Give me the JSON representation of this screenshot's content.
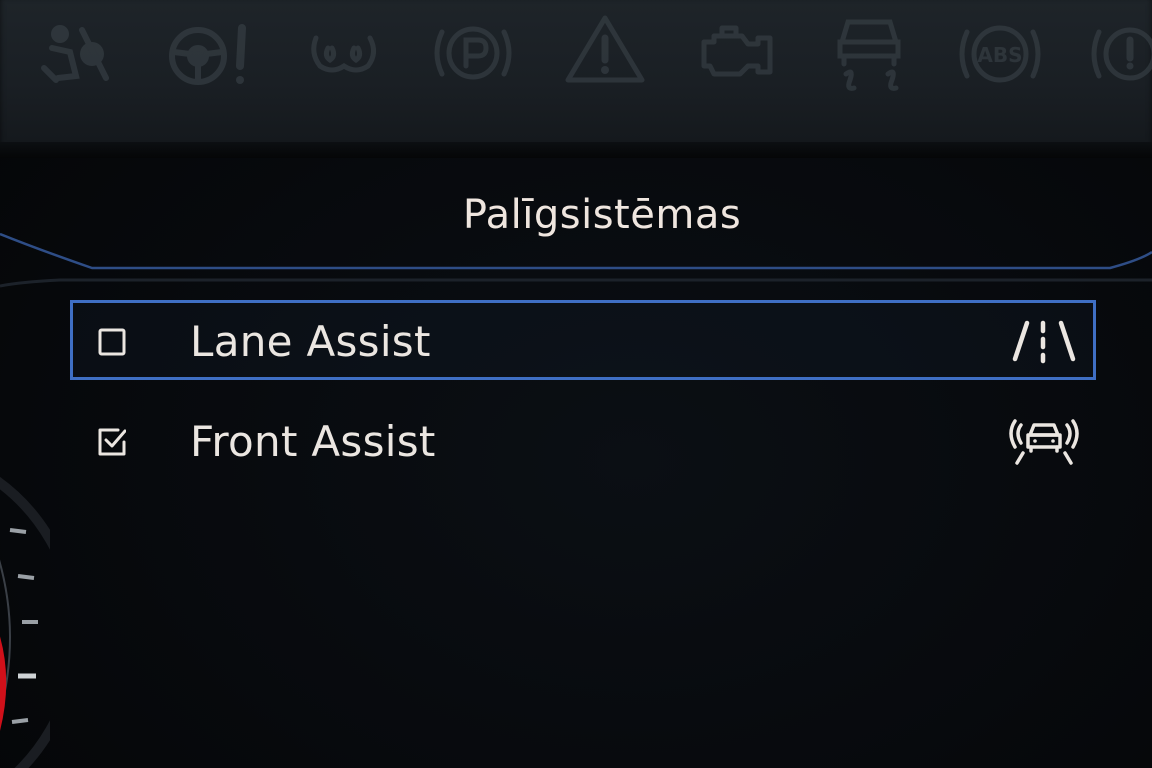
{
  "screen": {
    "title": "Palīgsistēmas"
  },
  "telltales": [
    {
      "icon": "airbag-off-icon"
    },
    {
      "icon": "steering-warning-icon"
    },
    {
      "icon": "glow-plug-icon"
    },
    {
      "icon": "parking-brake-icon"
    },
    {
      "icon": "hazard-warning-icon"
    },
    {
      "icon": "check-engine-icon"
    },
    {
      "icon": "traction-control-icon"
    },
    {
      "icon": "abs-icon"
    },
    {
      "icon": "brake-warning-icon"
    }
  ],
  "menu": {
    "items": [
      {
        "label": "Lane Assist",
        "checked": false,
        "selected": true,
        "icon": "lane-assist-icon"
      },
      {
        "label": "Front Assist",
        "checked": true,
        "selected": false,
        "icon": "front-assist-icon"
      }
    ]
  },
  "colors": {
    "selection_border": "#3f6fc4",
    "text": "#ebe6e1",
    "background": "#07090c",
    "gauge_accent": "#d0101a"
  }
}
